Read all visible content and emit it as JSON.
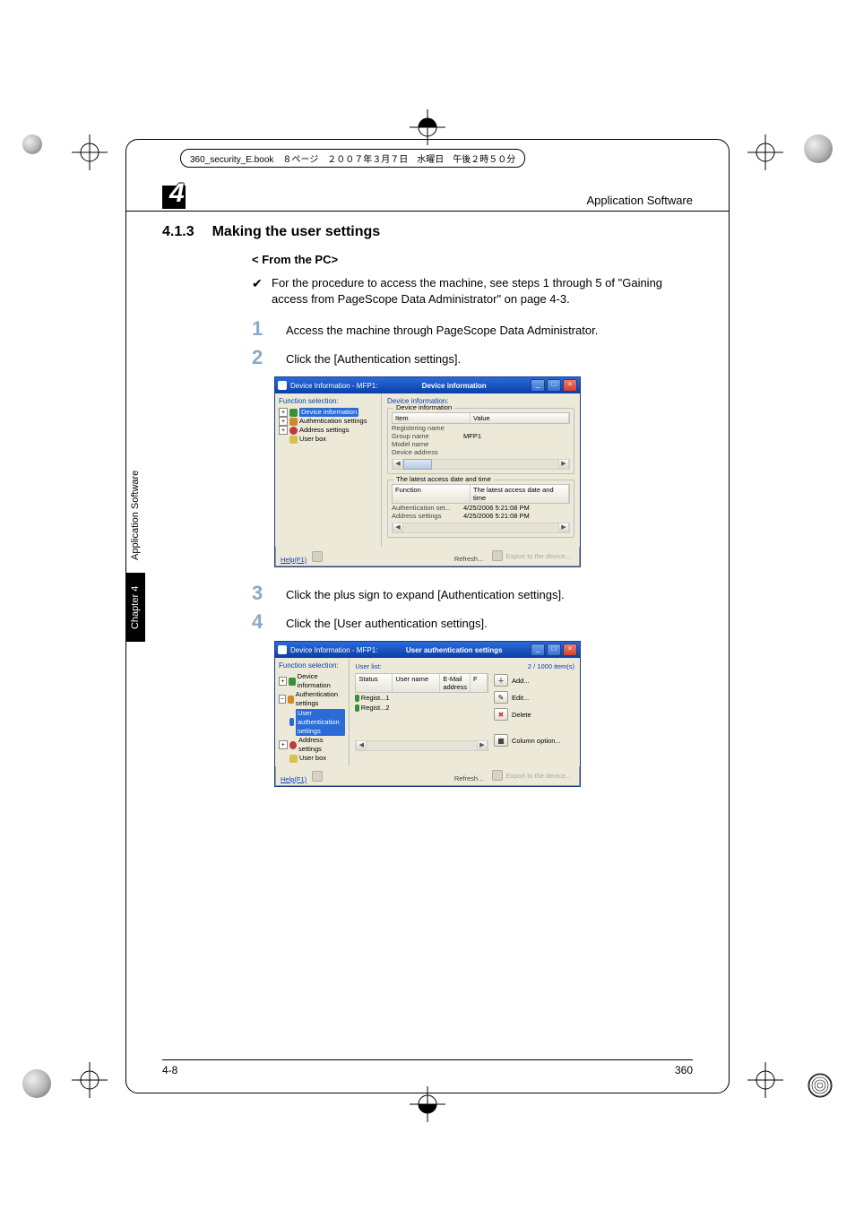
{
  "header": {
    "book_line": "360_security_E.book　８ページ　２００７年３月７日　水曜日　午後２時５０分",
    "running_title": "Application Software",
    "chapter_number": "4"
  },
  "side_tab": {
    "chapter_label": "Chapter 4",
    "section_label": "Application Software"
  },
  "section": {
    "number": "4.1.3",
    "title": "Making the user settings"
  },
  "subhead": "< From the PC>",
  "check_note": "For the procedure to access the machine, see steps 1 through 5 of \"Gaining access from PageScope Data Administrator\" on page 4-3.",
  "steps": {
    "s1": {
      "n": "1",
      "t": "Access the machine through PageScope Data Administrator."
    },
    "s2": {
      "n": "2",
      "t": "Click the [Authentication settings]."
    },
    "s3": {
      "n": "3",
      "t": "Click the plus sign to expand [Authentication settings]."
    },
    "s4": {
      "n": "4",
      "t": "Click the [User authentication settings]."
    }
  },
  "win1": {
    "title_left": "Device Information - MFP1:",
    "title_center": "Device information",
    "left_label": "Function selection:",
    "tree": {
      "n1": "Device information",
      "n2": "Authentication settings",
      "n3": "Address settings",
      "n4": "User box"
    },
    "right_label": "Device information:",
    "group1_title": "Device information",
    "group1_head_item": "Item",
    "group1_head_value": "Value",
    "rows": {
      "r1k": "Registering name",
      "r2k": "Group name",
      "r2v": "MFP1",
      "r3k": "Model name",
      "r4k": "Device address"
    },
    "group2_title": "The latest access date and time",
    "group2_head_func": "Function",
    "group2_head_date": "The latest access date and time",
    "g2": {
      "r1k": "Authentication set...",
      "r1v": "4/25/2006 5:21:08 PM",
      "r2k": "Address settings",
      "r2v": "4/25/2006 5:21:08 PM"
    },
    "help": "Help(F1)",
    "refresh": "Refresh...",
    "export": "Export to the device..."
  },
  "win2": {
    "title_left": "Device Information - MFP1:",
    "title_center": "User authentication settings",
    "left_label": "Function selection:",
    "tree": {
      "n1": "Device information",
      "n2": "Authentication settings",
      "n2a": "User authentication settings",
      "n3": "Address settings",
      "n4": "User box"
    },
    "list_label": "User list:",
    "count": "2 / 1000 item(s)",
    "head_status": "Status",
    "head_user": "User name",
    "head_email": "E-Mail address",
    "head_f": "F",
    "rows": {
      "r1s": "Regist...",
      "r1u": "1",
      "r2s": "Regist...",
      "r2u": "2"
    },
    "btns": {
      "add": "Add...",
      "edit": "Edit...",
      "delete": "Delete",
      "col": "Column option..."
    },
    "help": "Help(F1)",
    "refresh": "Refresh...",
    "export": "Export to the device..."
  },
  "footer": {
    "left": "4-8",
    "right": "360"
  }
}
